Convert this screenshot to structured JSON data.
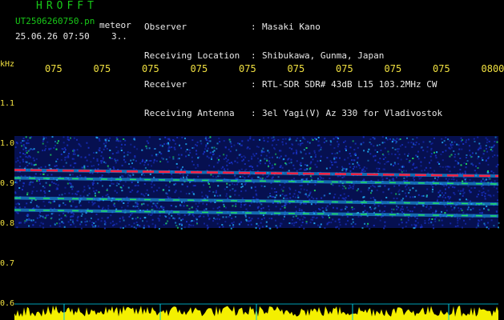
{
  "header": {
    "brand": "HROFFT",
    "file_name": "UT2506260750.pn",
    "file_tag": "meteor",
    "datetime": "25.06.26 07:50",
    "date_tag": "3.."
  },
  "meta": {
    "labels": [
      "Observer",
      "Receiving Location",
      "Receiver",
      "Receiving Antenna"
    ],
    "separator": ":",
    "values": [
      "Masaki Kano",
      "Shibukawa, Gunma, Japan",
      "RTL-SDR SDR# 43dB L15 103.2MHz CW",
      "3el Yagi(V) Az 330 for Vladivostok"
    ]
  },
  "colors": {
    "title_green": "#18c818",
    "axis_yellow": "#f0e040",
    "trace_red": "#ff2040",
    "trace_green": "#20e060",
    "noise_blue": "#1830c0",
    "signal_cyan": "#20a8f0",
    "meter_yellow": "#f4f000",
    "grid_cyan": "#00c8e0"
  },
  "chart_data": {
    "type": "heatmap",
    "ylabel": "kHz",
    "y_ticks": [
      "1.1",
      "1.0",
      "0.9",
      "0.8",
      "0.7",
      "0.6"
    ],
    "x_ticks": [
      "075",
      "075",
      "075",
      "075",
      "075",
      "075",
      "075",
      "075",
      "075",
      "0800"
    ],
    "ylim": [
      0.6,
      1.1
    ],
    "traces_khz": [
      0.93,
      0.91,
      0.86,
      0.83
    ],
    "band_khz": [
      0.79,
      1.02
    ]
  }
}
